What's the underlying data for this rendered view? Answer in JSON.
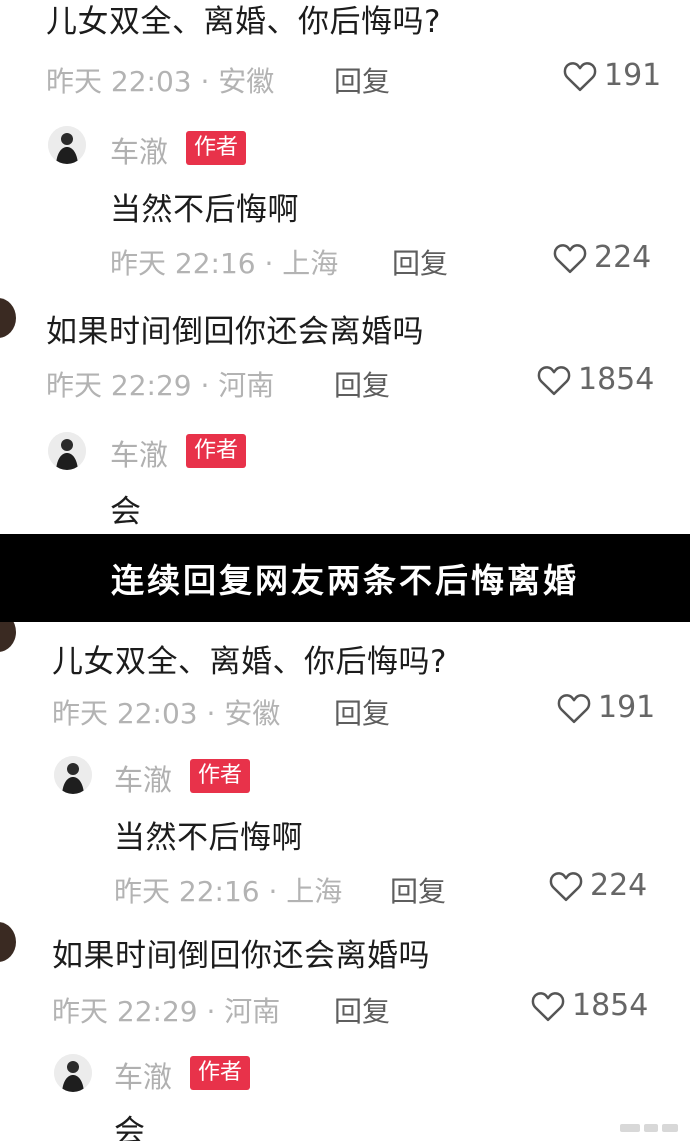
{
  "banner": "连续回复网友两条不后悔离婚",
  "panels": [
    {
      "thread1": {
        "comment": "儿女双全、离婚、你后悔吗?",
        "meta": "昨天 22:03 · 安徽",
        "reply_label": "回复",
        "likes": "191",
        "author_reply": {
          "author": "车澈",
          "badge": "作者",
          "text": "当然不后悔啊",
          "meta": "昨天 22:16 · 上海",
          "reply_label": "回复",
          "likes": "224"
        }
      },
      "thread2": {
        "comment": "如果时间倒回你还会离婚吗",
        "meta": "昨天 22:29 · 河南",
        "reply_label": "回复",
        "likes": "1854",
        "author_reply": {
          "author": "车澈",
          "badge": "作者",
          "text": "会"
        }
      }
    },
    {
      "thread1": {
        "comment": "儿女双全、离婚、你后悔吗?",
        "meta": "昨天 22:03 · 安徽",
        "reply_label": "回复",
        "likes": "191",
        "author_reply": {
          "author": "车澈",
          "badge": "作者",
          "text": "当然不后悔啊",
          "meta": "昨天 22:16 · 上海",
          "reply_label": "回复",
          "likes": "224"
        }
      },
      "thread2": {
        "comment": "如果时间倒回你还会离婚吗",
        "meta": "昨天 22:29 · 河南",
        "reply_label": "回复",
        "likes": "1854",
        "author_reply": {
          "author": "车澈",
          "badge": "作者",
          "text": "会"
        }
      }
    }
  ],
  "icons": {
    "like": "heart-outline-icon",
    "avatar": "author-avatar"
  },
  "colors": {
    "badge": "#e8324a",
    "banner_bg": "#000000",
    "banner_text": "#ffffff",
    "meta_text": "#b3b3b3"
  }
}
